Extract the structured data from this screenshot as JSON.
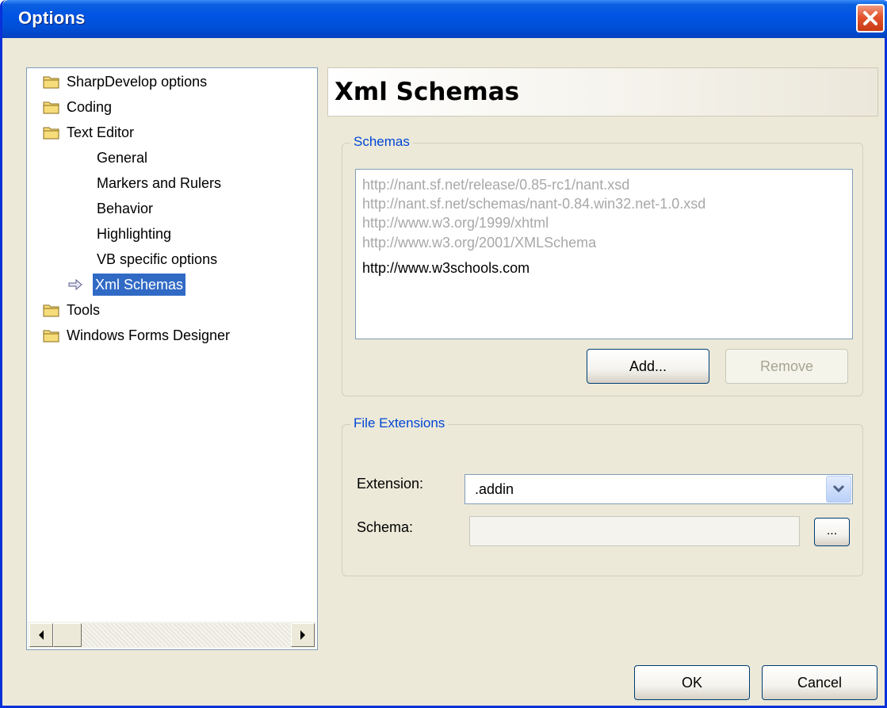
{
  "window": {
    "title": "Options"
  },
  "tree": {
    "items": [
      {
        "label": "SharpDevelop options",
        "folder": true
      },
      {
        "label": "Coding",
        "folder": true
      },
      {
        "label": "Text Editor",
        "folder": true
      },
      {
        "label": "General",
        "folder": false
      },
      {
        "label": "Markers and Rulers",
        "folder": false
      },
      {
        "label": "Behavior",
        "folder": false
      },
      {
        "label": "Highlighting",
        "folder": false
      },
      {
        "label": "VB specific options",
        "folder": false
      },
      {
        "label": "Xml Schemas",
        "folder": false,
        "selected": true
      },
      {
        "label": "Tools",
        "folder": true
      },
      {
        "label": "Windows Forms Designer",
        "folder": true
      }
    ]
  },
  "panel": {
    "title": "Xml Schemas"
  },
  "schemas": {
    "legend": "Schemas",
    "items": [
      {
        "url": "http://nant.sf.net/release/0.85-rc1/nant.xsd",
        "dimmed": true
      },
      {
        "url": "http://nant.sf.net/schemas/nant-0.84.win32.net-1.0.xsd",
        "dimmed": true
      },
      {
        "url": "http://www.w3.org/1999/xhtml",
        "dimmed": true
      },
      {
        "url": "http://www.w3.org/2001/XMLSchema",
        "dimmed": true
      },
      {
        "url": "http://www.w3schools.com",
        "dimmed": false
      }
    ],
    "add_label": "Add...",
    "remove_label": "Remove"
  },
  "file_extensions": {
    "legend": "File Extensions",
    "extension_label": "Extension:",
    "extension_value": ".addin",
    "schema_label": "Schema:",
    "schema_value": "",
    "browse_label": "..."
  },
  "footer": {
    "ok_label": "OK",
    "cancel_label": "Cancel"
  }
}
